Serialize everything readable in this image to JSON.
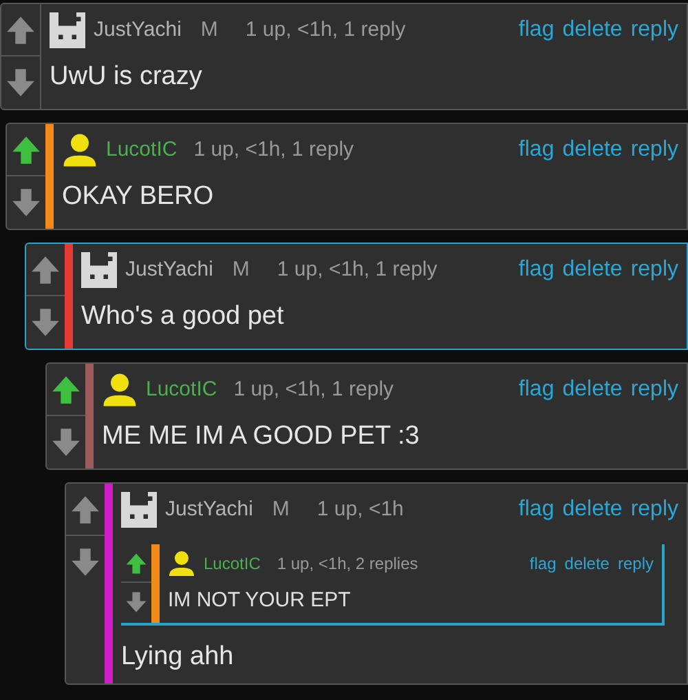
{
  "comments": [
    {
      "avatar": {
        "kind": "pixel"
      },
      "author": {
        "name": "JustYachi",
        "color": "#b4b4b4"
      },
      "badge": "M",
      "meta": "1 up, <1h, 1 reply",
      "actions": [
        "flag",
        "delete",
        "reply"
      ],
      "text": "UwU is crazy",
      "upvoted": false,
      "highlighted": false,
      "children": [
        {
          "avatar": {
            "kind": "person"
          },
          "author": {
            "name": "LucotIC",
            "color": "#4caf50"
          },
          "meta": "1 up, <1h, 1 reply",
          "actions": [
            "flag",
            "delete",
            "reply"
          ],
          "text": "OKAY BERO",
          "upvoted": true,
          "highlighted": false,
          "color": "#f28a1a",
          "children": [
            {
              "avatar": {
                "kind": "pixel"
              },
              "author": {
                "name": "JustYachi",
                "color": "#b4b4b4"
              },
              "badge": "M",
              "meta": "1 up, <1h, 1 reply",
              "actions": [
                "flag",
                "delete",
                "reply"
              ],
              "text": "Who's a good pet",
              "upvoted": false,
              "highlighted": true,
              "color": "#e53935",
              "children": [
                {
                  "avatar": {
                    "kind": "person"
                  },
                  "author": {
                    "name": "LucotIC",
                    "color": "#4caf50"
                  },
                  "meta": "1 up, <1h, 1 reply",
                  "actions": [
                    "flag",
                    "delete",
                    "reply"
                  ],
                  "text": "ME ME IM A GOOD PET :3",
                  "upvoted": true,
                  "highlighted": false,
                  "color": "#9c5a5a",
                  "children": [
                    {
                      "avatar": {
                        "kind": "pixel"
                      },
                      "author": {
                        "name": "JustYachi",
                        "color": "#b4b4b4"
                      },
                      "badge": "M",
                      "meta": "1 up, <1h",
                      "actions": [
                        "flag",
                        "delete",
                        "reply"
                      ],
                      "text": "Lying ahh",
                      "upvoted": false,
                      "highlighted": false,
                      "color": "#d01bc9",
                      "embedded": {
                        "avatar": {
                          "kind": "person"
                        },
                        "author": {
                          "name": "LucotIC",
                          "color": "#4caf50"
                        },
                        "meta": "1 up, <1h, 2 replies",
                        "actions": [
                          "flag",
                          "delete",
                          "reply"
                        ],
                        "text": "IM NOT YOUR EPT",
                        "upvoted": true,
                        "highlighted": true,
                        "color": "#f28a1a"
                      }
                    }
                  ]
                }
              ]
            }
          ]
        }
      ]
    }
  ]
}
